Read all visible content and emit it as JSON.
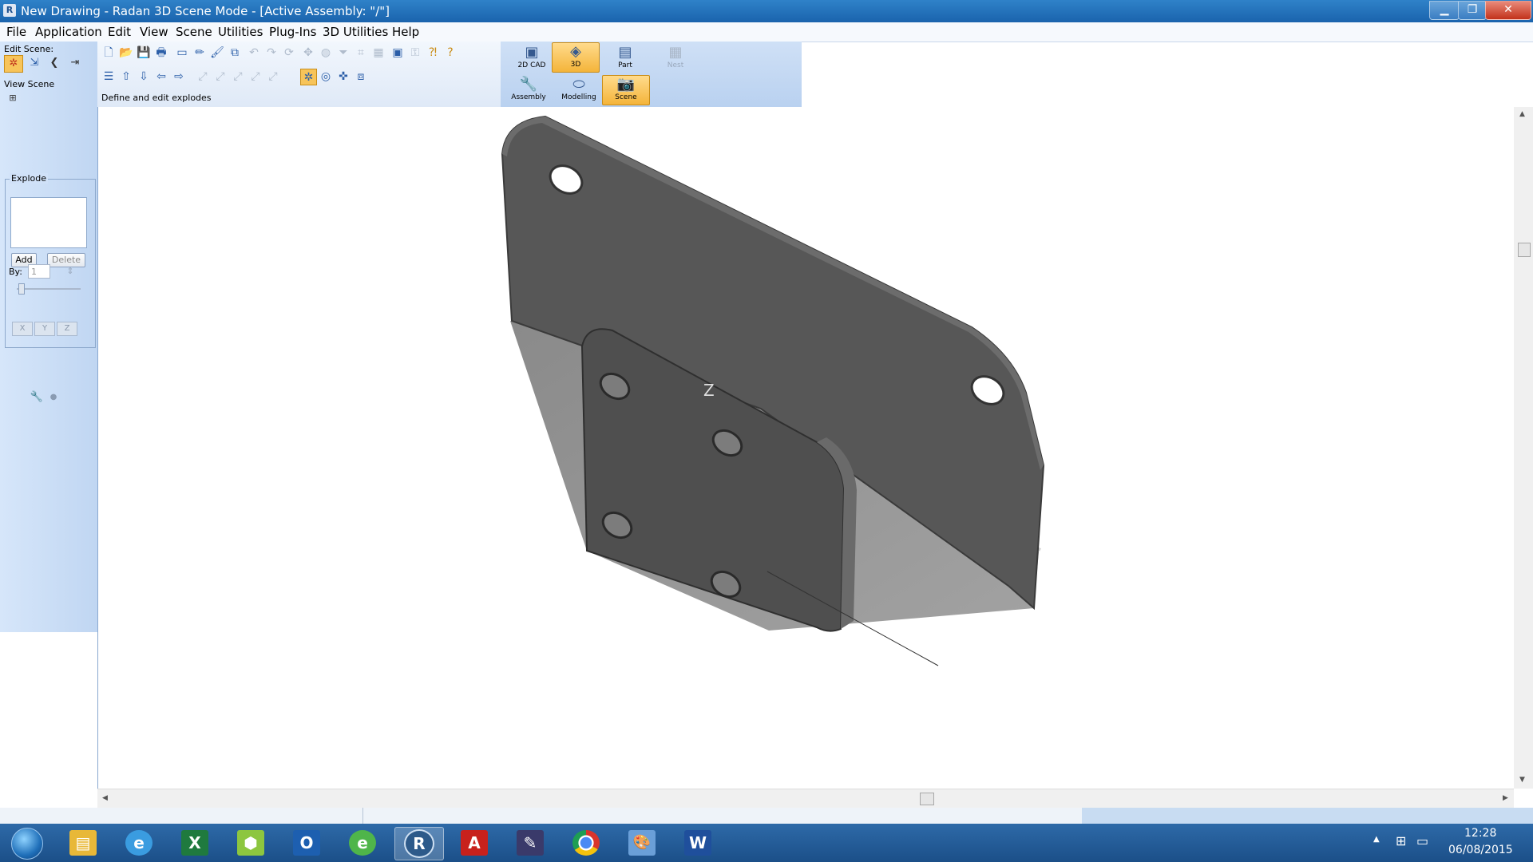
{
  "window": {
    "title": "New Drawing - Radan 3D Scene Mode - [Active Assembly: \"/\"]",
    "app_icon_letter": "R",
    "minimize": "▁",
    "maximize": "❐",
    "close": "✕"
  },
  "menu": [
    "File",
    "Application",
    "Edit",
    "View",
    "Scene",
    "Utilities",
    "Plug-Ins",
    "3D Utilities",
    "Help"
  ],
  "left_panel": {
    "edit_scene_label": "Edit Scene:",
    "view_scene_label": "View Scene",
    "explode": {
      "group_label": "Explode",
      "add_label": "Add",
      "delete_label": "Delete",
      "by_label": "By:",
      "by_value": "1",
      "axis_buttons": [
        "X",
        "Y",
        "Z"
      ]
    }
  },
  "toolbar": {
    "status_text": "Define and edit explodes"
  },
  "ribbon": {
    "modes": [
      {
        "label": "2D CAD",
        "icon": "2d-cad-icon",
        "active": false
      },
      {
        "label": "3D",
        "icon": "3d-icon",
        "active": true
      },
      {
        "label": "Part",
        "icon": "part-icon",
        "active": false
      },
      {
        "label": "Nest",
        "icon": "nest-icon",
        "active": false,
        "disabled": true
      }
    ],
    "submodes": [
      {
        "label": "Assembly",
        "icon": "wrench-icon",
        "active": false
      },
      {
        "label": "Modelling",
        "icon": "modelling-icon",
        "active": false
      },
      {
        "label": "Scene",
        "icon": "camera-icon",
        "active": true
      }
    ]
  },
  "viewport": {
    "axis_label": "Z",
    "background": "#ffffff",
    "part_color": "#545454"
  },
  "taskbar": {
    "apps": [
      {
        "name": "file-explorer",
        "glyph": "▤",
        "color": "#e8b838"
      },
      {
        "name": "internet-explorer",
        "glyph": "e",
        "color": "#3a9ce0"
      },
      {
        "name": "excel",
        "glyph": "X",
        "color": "#1f7a3e"
      },
      {
        "name": "cad-viewer",
        "glyph": "⬢",
        "color": "#8dc63f"
      },
      {
        "name": "outlook",
        "glyph": "O",
        "color": "#1d5fb0"
      },
      {
        "name": "ie-edge",
        "glyph": "e",
        "color": "#4fb54a"
      },
      {
        "name": "radan",
        "glyph": "R",
        "color": "#2d5a8a"
      },
      {
        "name": "acrobat",
        "glyph": "A",
        "color": "#c8211c"
      },
      {
        "name": "knife-tool",
        "glyph": "✎",
        "color": "#3a3a6a"
      },
      {
        "name": "chrome",
        "glyph": "●",
        "color": "#d9342b"
      },
      {
        "name": "paint",
        "glyph": "🎨",
        "color": "#6a9fd8"
      },
      {
        "name": "word",
        "glyph": "W",
        "color": "#1f4f9c"
      }
    ],
    "clock_time": "12:28",
    "clock_date": "06/08/2015"
  }
}
